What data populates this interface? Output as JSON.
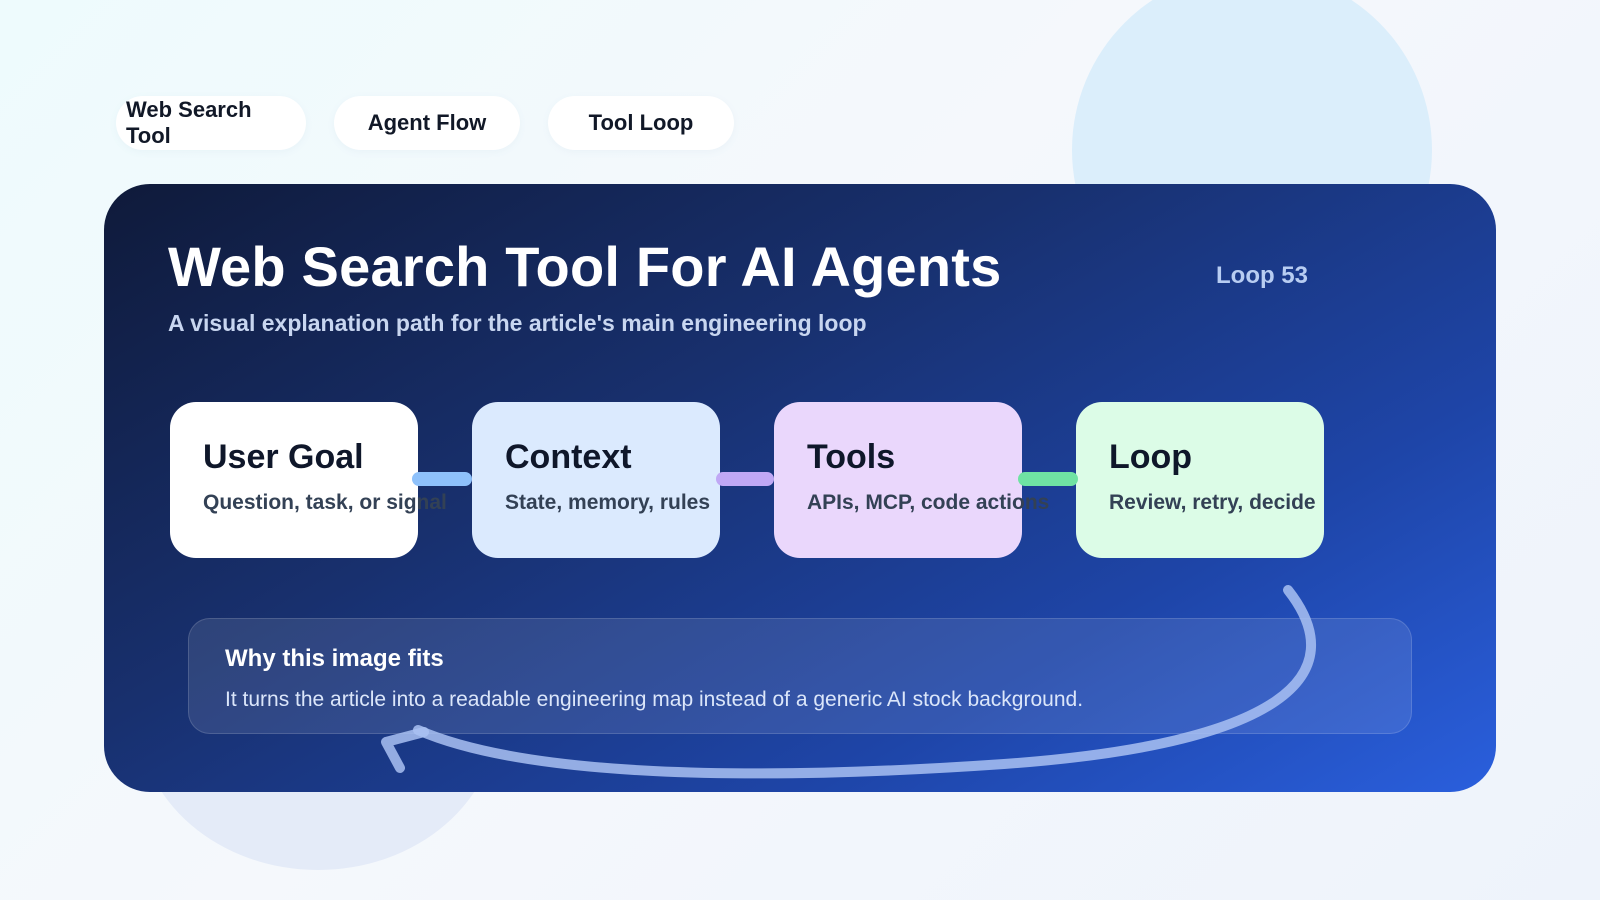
{
  "tabs": [
    {
      "label": "Web Search Tool"
    },
    {
      "label": "Agent Flow"
    },
    {
      "label": "Tool Loop"
    }
  ],
  "card": {
    "title": "Web Search Tool For AI Agents",
    "subtitle": "A visual explanation path for the article's main engineering loop",
    "loop_badge": "Loop 53"
  },
  "nodes": [
    {
      "title": "User Goal",
      "desc": "Question, task, or signal"
    },
    {
      "title": "Context",
      "desc": "State, memory, rules"
    },
    {
      "title": "Tools",
      "desc": "APIs, MCP, code actions"
    },
    {
      "title": "Loop",
      "desc": "Review, retry, decide"
    }
  ],
  "why": {
    "title": "Why this image fits",
    "text": "It turns the article into a readable engineering map instead of a generic AI stock background."
  },
  "colors": {
    "connector_1": "#8ec1fb",
    "connector_2": "#c0a8f5",
    "connector_3": "#6fe3a3",
    "loop_arrow": "#a9c1f2"
  }
}
